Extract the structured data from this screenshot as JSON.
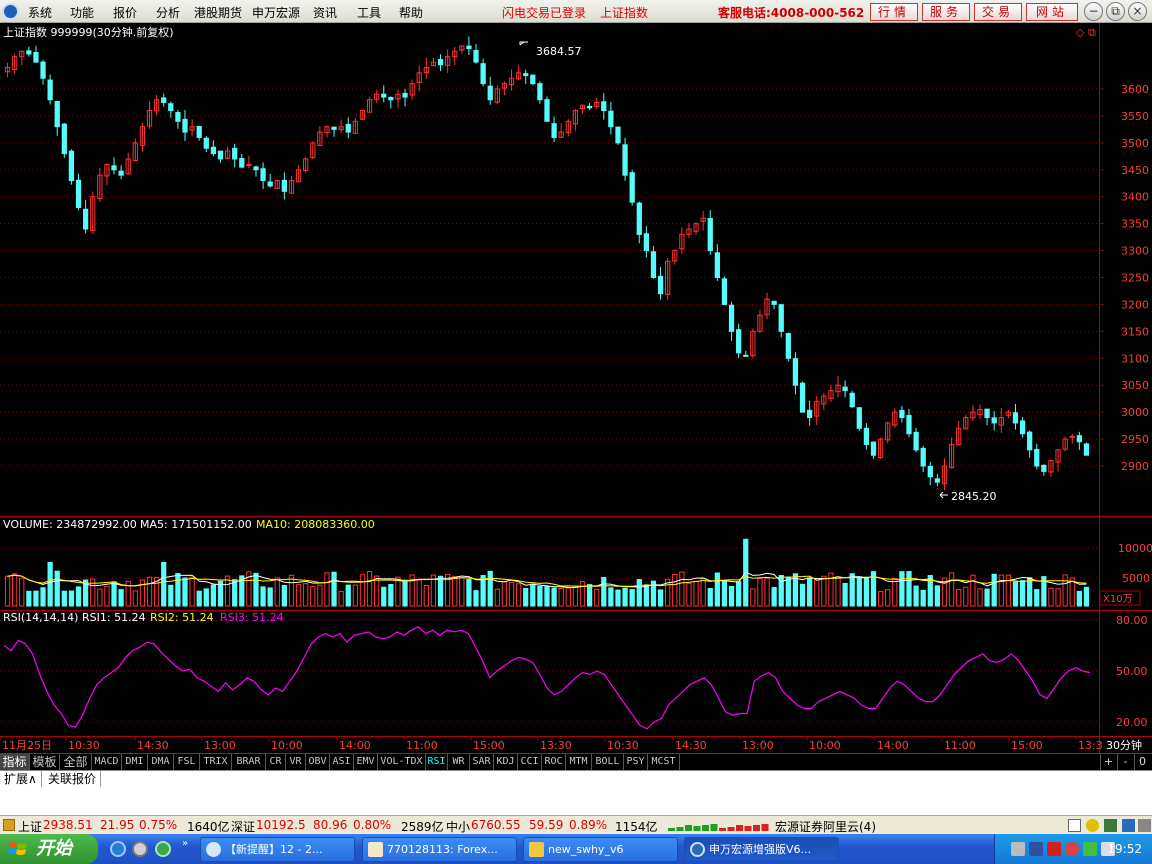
{
  "menubar": {
    "items": [
      "系统",
      "功能",
      "报价",
      "分析",
      "港股期货",
      "申万宏源",
      "资讯",
      "工具",
      "帮助"
    ],
    "notice1": "闪电交易已登录",
    "notice2": "上证指数",
    "hotline": "客服电话:4008-000-562",
    "buttons": [
      "行情",
      "服务",
      "交易",
      "网站"
    ],
    "window_controls": [
      "−",
      "⧉",
      "×"
    ]
  },
  "chart": {
    "title": "上证指数 999999(30分钟.前复权)",
    "high_label": "3684.57",
    "low_label": "2845.20",
    "price_ticks": [
      "3600",
      "3550",
      "3500",
      "3450",
      "3400",
      "3350",
      "3300",
      "3250",
      "3200",
      "3150",
      "3100",
      "3050",
      "3000",
      "2950",
      "2900"
    ],
    "volume_header": {
      "vol": "VOLUME: 234872992.00",
      "ma5": "MA5: 171501152.00",
      "ma10": "MA10: 208083360.00"
    },
    "volume_ticks": [
      "10000",
      "5000"
    ],
    "volume_unit": "X10万",
    "rsi_header": {
      "name": "RSI(14,14,14)",
      "rsi1": "RSI1: 51.24",
      "rsi2": "RSI2: 51.24",
      "rsi3": "RSI3: 51.24"
    },
    "rsi_ticks": [
      "80.00",
      "50.00",
      "20.00"
    ],
    "time_labels": [
      "11月25日",
      "10:30",
      "14:30",
      "13:00",
      "10:00",
      "14:00",
      "11:00",
      "15:00",
      "13:30",
      "10:30",
      "14:30",
      "13:00",
      "10:00",
      "14:00",
      "11:00",
      "15:00",
      "13:3"
    ],
    "period": "30分钟",
    "colors": {
      "up": "#ff3232",
      "down": "#54fcfc",
      "ma5": "#ffffff",
      "ma10": "#ffff00",
      "rsi": "#ff00ff",
      "grid": "#8b0000",
      "axis_text": "#ff3c3c"
    }
  },
  "chart_data": [
    {
      "type": "candlestick",
      "title": "上证指数 999999(30分钟.前复权)",
      "ylim": [
        2820,
        3700
      ],
      "annotations": [
        {
          "label": "3684.57",
          "kind": "max"
        },
        {
          "label": "2845.20",
          "kind": "min"
        }
      ],
      "closes": [
        3640,
        3660,
        3670,
        3665,
        3650,
        3620,
        3580,
        3530,
        3480,
        3430,
        3380,
        3340,
        3400,
        3440,
        3460,
        3450,
        3440,
        3470,
        3500,
        3530,
        3560,
        3580,
        3575,
        3560,
        3540,
        3520,
        3530,
        3510,
        3490,
        3480,
        3470,
        3485,
        3470,
        3455,
        3460,
        3450,
        3430,
        3420,
        3430,
        3410,
        3430,
        3450,
        3470,
        3500,
        3520,
        3530,
        3525,
        3530,
        3520,
        3540,
        3560,
        3580,
        3590,
        3585,
        3580,
        3590,
        3585,
        3610,
        3630,
        3640,
        3650,
        3645,
        3660,
        3670,
        3680,
        3675,
        3650,
        3610,
        3580,
        3600,
        3610,
        3620,
        3630,
        3625,
        3610,
        3580,
        3540,
        3510,
        3520,
        3540,
        3560,
        3570,
        3565,
        3575,
        3560,
        3530,
        3500,
        3440,
        3390,
        3330,
        3300,
        3250,
        3220,
        3280,
        3300,
        3330,
        3340,
        3350,
        3360,
        3300,
        3250,
        3200,
        3150,
        3110,
        3105,
        3150,
        3180,
        3210,
        3200,
        3150,
        3100,
        3050,
        3000,
        2990,
        3020,
        3030,
        3040,
        3050,
        3040,
        3010,
        2970,
        2940,
        2920,
        2950,
        2980,
        3000,
        2990,
        2960,
        2930,
        2900,
        2880,
        2870,
        2900,
        2940,
        2970,
        2990,
        3000,
        3005,
        2990,
        2980,
        2990,
        3000,
        2980,
        2960,
        2930,
        2900,
        2890,
        2910,
        2930,
        2950,
        2955,
        2945,
        2920
      ]
    },
    {
      "type": "bar",
      "title": "VOLUME",
      "ylabel": "X10万",
      "ylim": [
        0,
        12000
      ],
      "series": [
        {
          "name": "VOLUME",
          "values_desc": "per-bar volumes"
        },
        {
          "name": "MA5",
          "values_desc": "moving average"
        },
        {
          "name": "MA10",
          "values_desc": "moving average"
        }
      ]
    },
    {
      "type": "line",
      "title": "RSI(14,14,14)",
      "ylim": [
        10,
        85
      ],
      "series": [
        {
          "name": "RSI",
          "values": [
            65,
            62,
            68,
            66,
            60,
            48,
            38,
            30,
            25,
            18,
            17,
            24,
            34,
            42,
            46,
            49,
            52,
            58,
            62,
            64,
            67,
            66,
            61,
            57,
            53,
            50,
            51,
            46,
            44,
            41,
            38,
            43,
            39,
            42,
            46,
            44,
            39,
            36,
            40,
            38,
            44,
            50,
            58,
            66,
            70,
            72,
            70,
            72,
            67,
            71,
            72,
            73,
            70,
            69,
            70,
            73,
            71,
            74,
            76,
            72,
            74,
            71,
            74,
            73,
            74,
            72,
            64,
            56,
            46,
            50,
            53,
            56,
            58,
            57,
            55,
            48,
            40,
            36,
            38,
            42,
            46,
            49,
            48,
            50,
            48,
            42,
            36,
            30,
            24,
            18,
            16,
            20,
            22,
            30,
            34,
            38,
            42,
            44,
            46,
            42,
            34,
            26,
            24,
            25,
            25,
            44,
            47,
            49,
            46,
            38,
            34,
            30,
            28,
            28,
            32,
            34,
            36,
            38,
            36,
            34,
            30,
            28,
            28,
            34,
            40,
            44,
            42,
            38,
            34,
            32,
            32,
            36,
            42,
            48,
            52,
            56,
            58,
            60,
            56,
            55,
            57,
            60,
            56,
            50,
            44,
            36,
            34,
            40,
            46,
            50,
            52,
            50,
            49
          ]
        }
      ]
    }
  ],
  "tabs": [
    "指标",
    "模板",
    "全部",
    "MACD",
    "DMI",
    "DMA",
    "FSL",
    "TRIX",
    "BRAR",
    "CR",
    "VR",
    "OBV",
    "ASI",
    "EMV",
    "VOL-TDX",
    "RSI",
    "WR",
    "SAR",
    "KDJ",
    "CCI",
    "ROC",
    "MTM",
    "BOLL",
    "PSY",
    "MCST"
  ],
  "tab_controls": [
    "+",
    "-",
    "0"
  ],
  "ext_tabs": [
    "扩展∧",
    "关联报价"
  ],
  "status": {
    "sh_label": "上证",
    "sh_value": "2938.51",
    "sh_change": "21.95",
    "sh_pct": "0.75%",
    "sh_amount": "1640亿",
    "sz_label": "深证",
    "sz_value": "10192.5",
    "sz_change": "80.96",
    "sz_pct": "0.80%",
    "sz_amount": "2589亿",
    "zx_label": "中小",
    "zx_value": "6760.55",
    "zx_change": "59.59",
    "zx_pct": "0.89%",
    "zx_amount": "1154亿",
    "server": "宏源证券阿里云(4)"
  },
  "taskbar": {
    "start": "开始",
    "buttons": [
      "【新提醒】12 - 2...",
      "770128113: Forex...",
      "new_swhy_v6",
      "申万宏源增强版V6..."
    ],
    "clock": "19:52"
  }
}
